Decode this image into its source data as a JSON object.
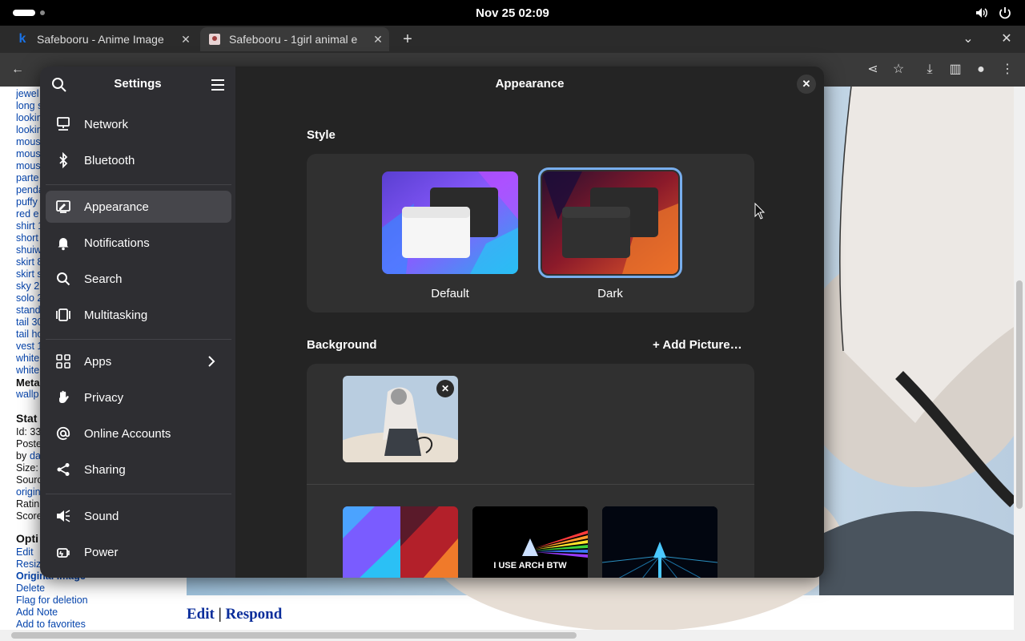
{
  "topbar": {
    "clock": "Nov 25  02:09"
  },
  "browser": {
    "tabs": [
      {
        "label": "Safebooru - Anime Image",
        "favicon": "k"
      },
      {
        "label": "Safebooru - 1girl animal e"
      }
    ]
  },
  "webpage": {
    "tags": [
      "jewel",
      "long s",
      "lookin",
      "lookin",
      "mous",
      "mous",
      "mous",
      "parte",
      "penda",
      "puffy",
      "red e",
      "shirt 1",
      "short",
      "shuiw",
      "skirt 8",
      "skirt s",
      "sky 2",
      "solo 2",
      "stand",
      "tail 30",
      "tail ho",
      "vest 1",
      "white",
      "white"
    ],
    "meta_head": "Meta",
    "meta_link": "wallp",
    "stats_head": "Stat",
    "stats": [
      "Id: 33",
      "Poste",
      "by",
      "Size:",
      "Sourc",
      "origin",
      "Ratin",
      "Score"
    ],
    "stats_by_link": "da",
    "options_head": "Opti",
    "options": [
      "Edit",
      "Resiz",
      "Original image",
      "Delete",
      "Flag for deletion",
      "Add Note",
      "Add to favorites"
    ],
    "edit_link": "Edit",
    "separator": "|",
    "respond_link": "Respond"
  },
  "settings": {
    "sidebar_title": "Settings",
    "nav": [
      {
        "label": "Network",
        "icon": "network-icon"
      },
      {
        "label": "Bluetooth",
        "icon": "bluetooth-icon"
      },
      {
        "label": "Appearance",
        "icon": "appearance-icon",
        "selected": true
      },
      {
        "label": "Notifications",
        "icon": "bell-icon"
      },
      {
        "label": "Search",
        "icon": "search-icon"
      },
      {
        "label": "Multitasking",
        "icon": "multitasking-icon"
      },
      {
        "label": "Apps",
        "icon": "apps-icon"
      },
      {
        "label": "Privacy",
        "icon": "hand-icon"
      },
      {
        "label": "Online Accounts",
        "icon": "at-icon"
      },
      {
        "label": "Sharing",
        "icon": "share-icon"
      },
      {
        "label": "Sound",
        "icon": "speaker-icon"
      },
      {
        "label": "Power",
        "icon": "power-icon"
      }
    ],
    "page_title": "Appearance",
    "style_label": "Style",
    "style_options": [
      {
        "label": "Default",
        "selected": false
      },
      {
        "label": "Dark",
        "selected": true
      }
    ],
    "background_label": "Background",
    "add_picture": "Add Picture…",
    "wallpaper_text_arch": "I USE ARCH BTW"
  },
  "colors": {
    "accent": "#78aeed",
    "link": "#0645ad"
  }
}
